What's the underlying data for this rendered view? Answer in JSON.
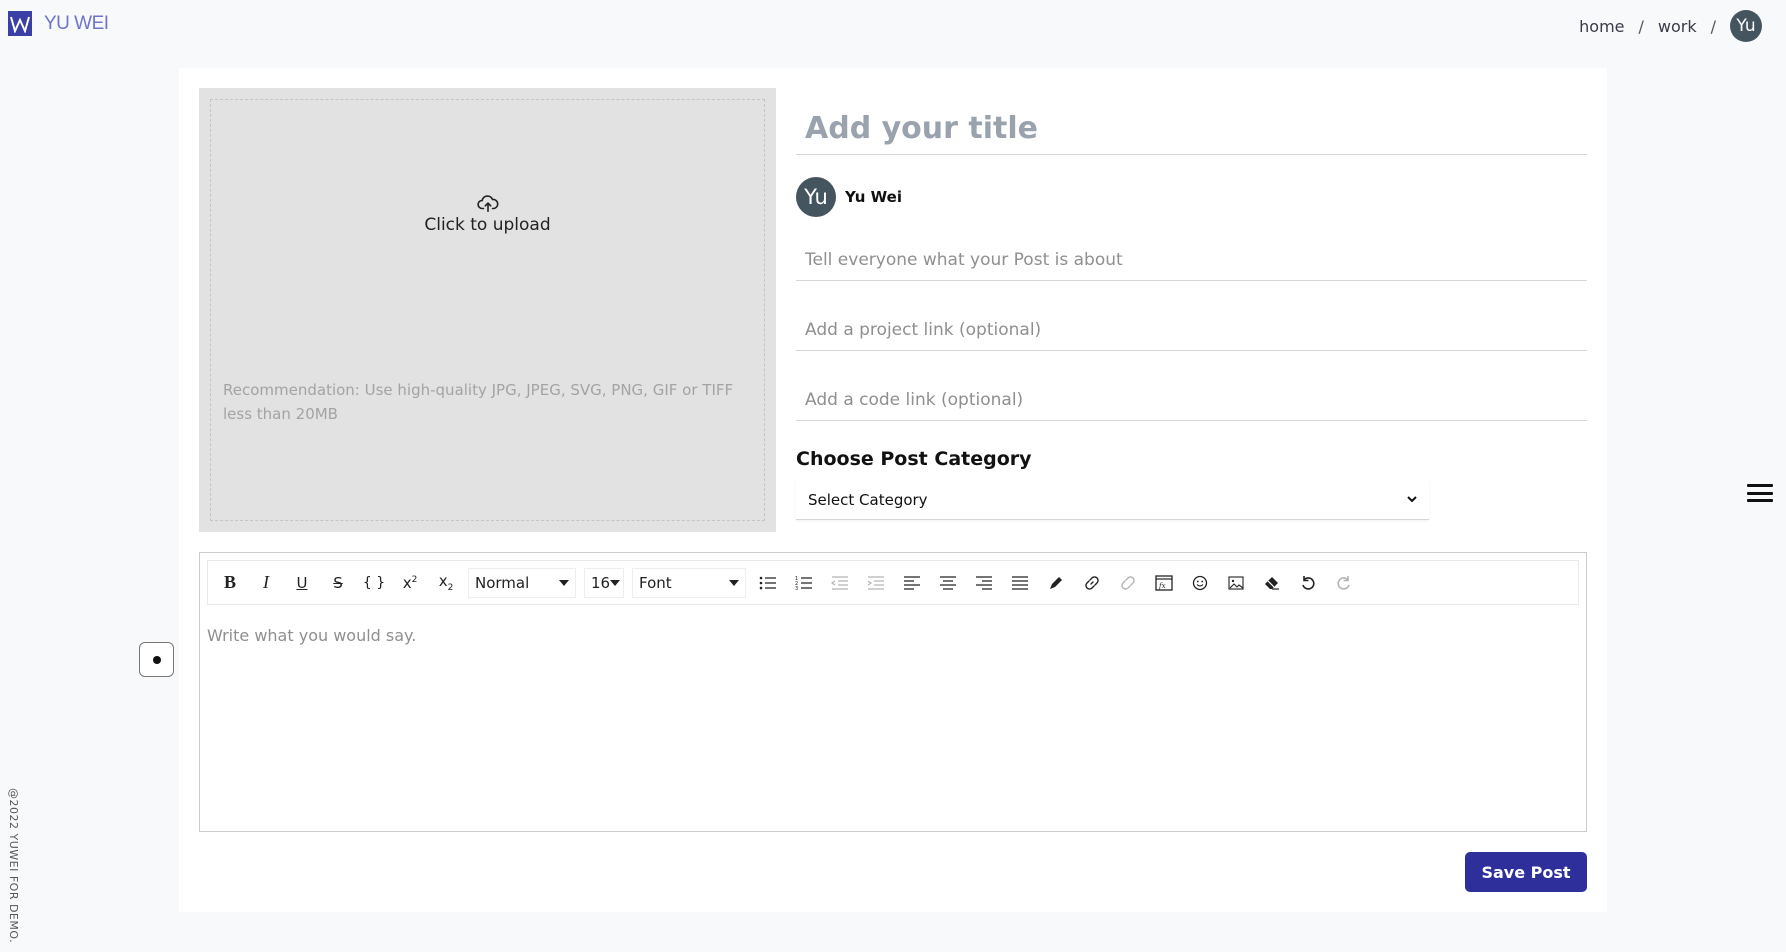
{
  "app": {
    "logo_text": "YU WEI",
    "brand_color": "#2f2f9c",
    "copyright": "@2022 YUWEI FOR DEMO."
  },
  "header": {
    "nav": [
      "home",
      "work"
    ],
    "separator": "/",
    "avatar_initials": "Yu"
  },
  "upload": {
    "label": "Click to upload",
    "recommendation": "Recommendation: Use high-quality JPG, JPEG, SVG, PNG, GIF or TIFF less than 20MB"
  },
  "form": {
    "title_placeholder": "Add your title",
    "author": {
      "initials": "Yu",
      "name": "Yu Wei"
    },
    "about_placeholder": "Tell everyone what your Post is about",
    "project_link_placeholder": "Add a project link (optional)",
    "code_link_placeholder": "Add a code link (optional)",
    "category_label": "Choose Post Category",
    "category_selected": "Select Category"
  },
  "editor": {
    "heading_select": "Normal",
    "size_select": "16",
    "font_select": "Font",
    "placeholder": "Write what you would say."
  },
  "actions": {
    "save_label": "Save Post"
  }
}
